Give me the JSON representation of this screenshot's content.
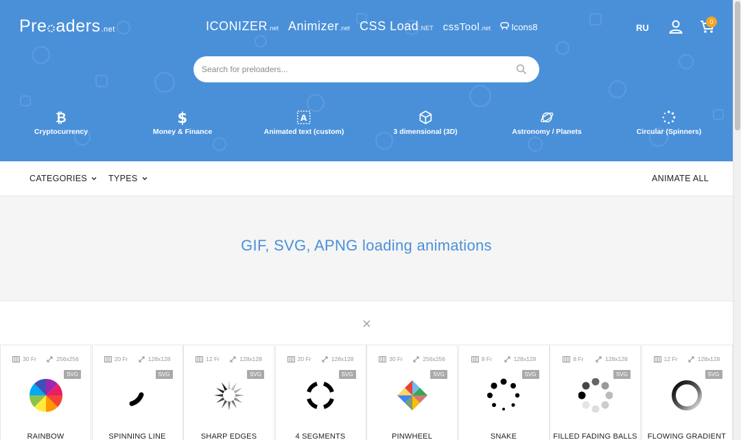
{
  "header": {
    "logo": {
      "left": "Pre",
      "right": "aders",
      "suffix": ".net"
    },
    "topnav": [
      {
        "name": "ICONIZER",
        "suffix": ".net"
      },
      {
        "name": "Animizer",
        "suffix": ".net"
      },
      {
        "name": "CSS Load",
        "suffix": ".NET"
      },
      {
        "name": "cssTool",
        "suffix": ".net"
      },
      {
        "name": "Icons8",
        "suffix": ""
      }
    ],
    "lang": "RU",
    "cart_count": "0"
  },
  "search": {
    "placeholder": "Search for preloaders..."
  },
  "categories": [
    {
      "label": "Cryptocurrency",
      "icon": "bitcoin-icon"
    },
    {
      "label": "Money & Finance",
      "icon": "dollar-icon"
    },
    {
      "label": "Animated text (custom)",
      "icon": "text-frame-icon"
    },
    {
      "label": "3 dimensional (3D)",
      "icon": "cube-icon"
    },
    {
      "label": "Astronomy / Planets",
      "icon": "planet-icon"
    },
    {
      "label": "Circular (Spinners)",
      "icon": "spinner-icon"
    }
  ],
  "filterbar": {
    "categories_label": "CATEGORIES",
    "types_label": "TYPES",
    "animate_all_label": "ANIMATE ALL"
  },
  "banner": {
    "title": "GIF, SVG, APNG loading animations"
  },
  "cards": [
    {
      "frames": "30 Fr",
      "size": "256x256",
      "format": "SVG",
      "name": "RAINBOW"
    },
    {
      "frames": "20 Fr",
      "size": "128x128",
      "format": "SVG",
      "name": "SPINNING LINE"
    },
    {
      "frames": "12 Fr",
      "size": "128x128",
      "format": "SVG",
      "name": "SHARP EDGES"
    },
    {
      "frames": "20 Fr",
      "size": "128x128",
      "format": "SVG",
      "name": "4 SEGMENTS"
    },
    {
      "frames": "30 Fr",
      "size": "256x256",
      "format": "SVG",
      "name": "PINWHEEL"
    },
    {
      "frames": "8 Fr",
      "size": "128x128",
      "format": "SVG",
      "name": "SNAKE"
    },
    {
      "frames": "8 Fr",
      "size": "128x128",
      "format": "SVG",
      "name": "FILLED FADING BALLS"
    },
    {
      "frames": "12 Fr",
      "size": "128x128",
      "format": "SVG",
      "name": "FLOWING GRADIENT"
    }
  ],
  "colors": {
    "brand": "#4a90d9",
    "badge": "#f5a623"
  }
}
